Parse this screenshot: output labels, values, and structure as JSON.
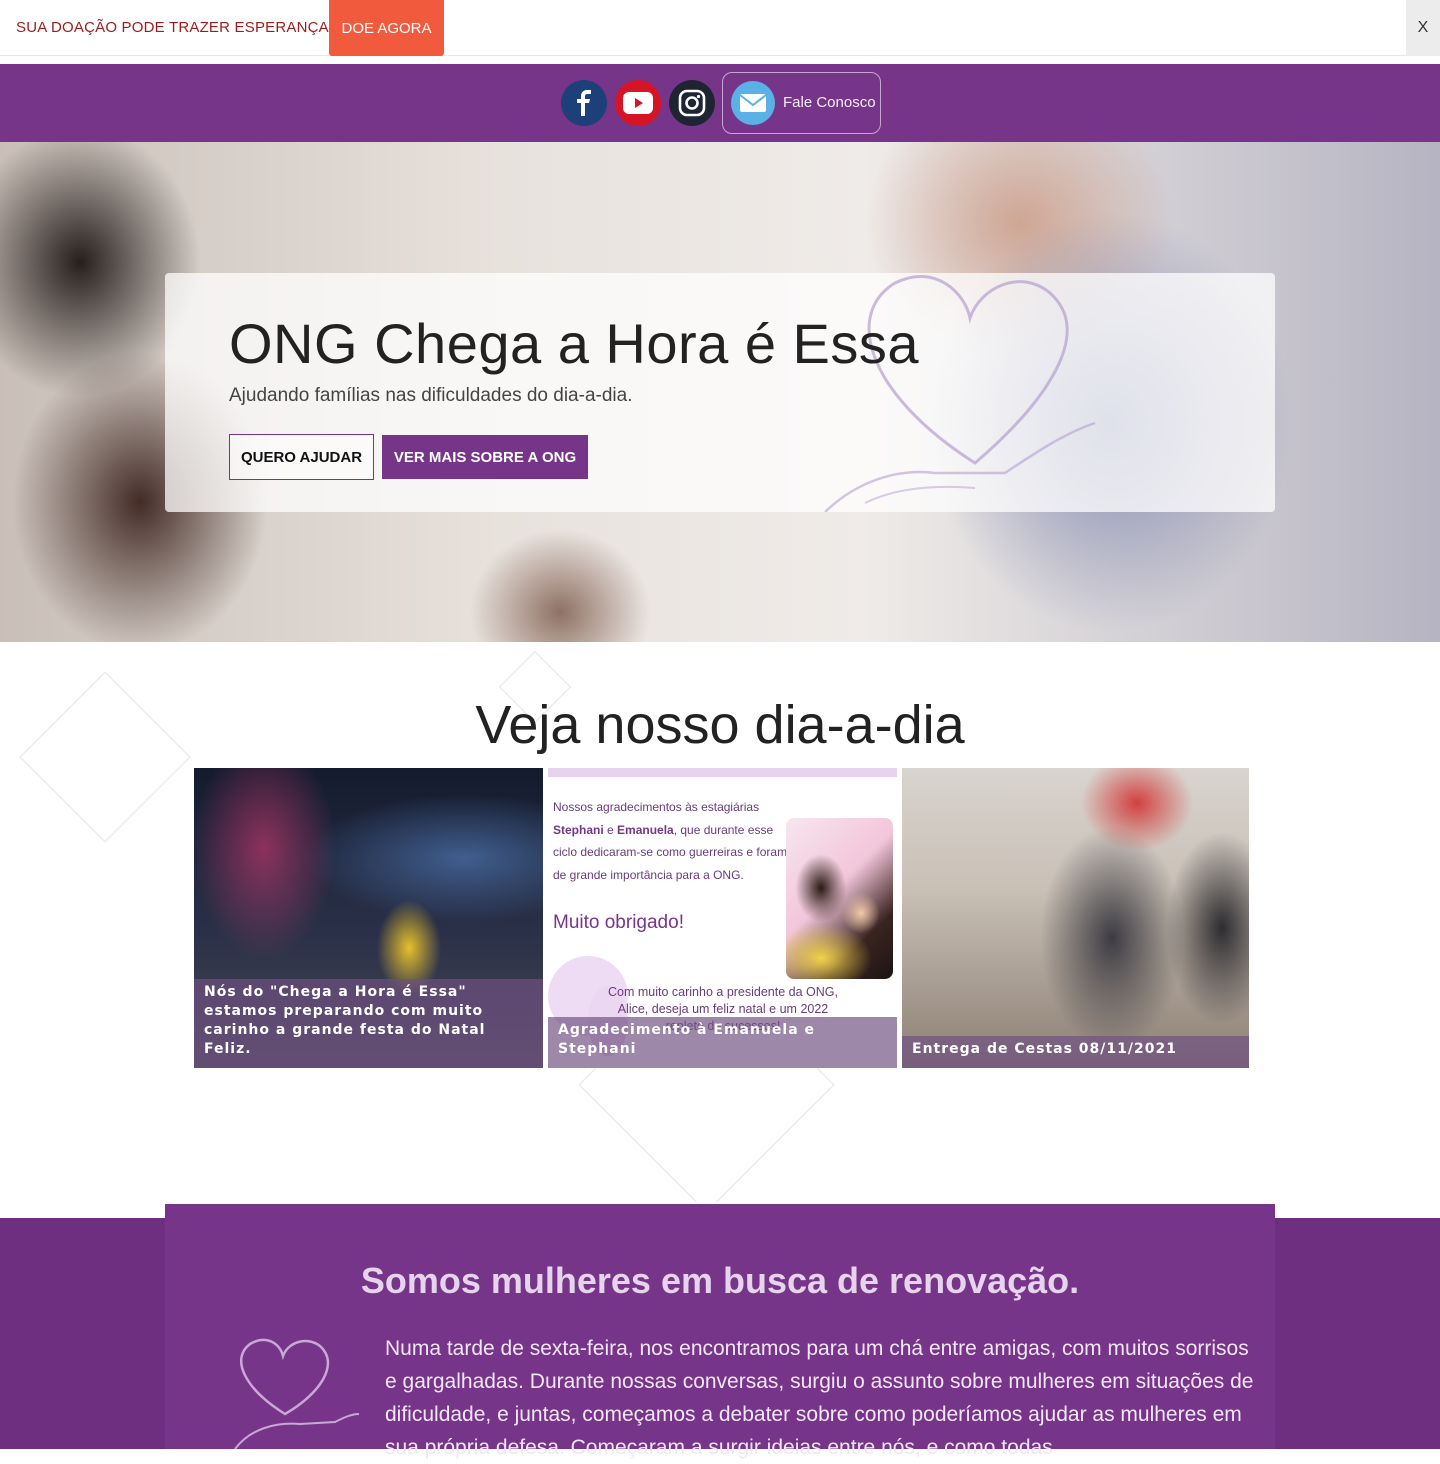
{
  "top_bar": {
    "message": "SUA DOAÇÃO PODE TRAZER ESPERANÇA.",
    "donate_button": "DOE AGORA",
    "close_button": "X",
    "message_color": "#9b1c1c",
    "donate_color": "#f15a3c"
  },
  "social": {
    "icons": [
      "facebook-icon",
      "youtube-icon",
      "instagram-icon",
      "mail-icon"
    ],
    "contact_label": "Fale Conosco",
    "bar_color": "#773589"
  },
  "hero": {
    "title": "ONG Chega a Hora é Essa",
    "subtitle": "Ajudando famílias nas dificuldades do dia-a-dia.",
    "primary_button": "QUERO AJUDAR",
    "secondary_button": "VER MAIS SOBRE A ONG"
  },
  "diary": {
    "title": "Veja nosso dia-a-dia",
    "cards": [
      {
        "caption": "Nós do \"Chega a Hora é Essa\" estamos preparando com muito carinho a grande festa do Natal Feliz."
      },
      {
        "caption": "Agradecimento à Emanuela e Stephani",
        "thanks_part1": "Nossos agradecimentos às estagiárias ",
        "name1": "Stephani",
        "thanks_part2": " e ",
        "name2": "Emanuela",
        "thanks_part3": ", que durante esse ciclo dedicaram-se como guerreiras e foram de grande importância para a ONG.",
        "highlight": "Muito obrigado!",
        "president_note": "Com muito carinho a presidente da ONG, Alice, deseja um feliz natal e um 2022 repleto de sucessos!"
      },
      {
        "caption": "Entrega de Cestas 08/11/2021"
      }
    ]
  },
  "about": {
    "title": "Somos mulheres em busca de renovação.",
    "text": "Numa tarde de sexta-feira, nos encontramos para um chá entre amigas, com muitos sorrisos e gargalhadas. Durante nossas conversas, surgiu o assunto sobre mulheres em situações de dificuldade, e juntas, começamos a debater sobre como poderíamos ajudar as mulheres em sua própria defesa. Começaram a surgir ideias entre nós, e como todas",
    "accent_color": "#773589"
  }
}
